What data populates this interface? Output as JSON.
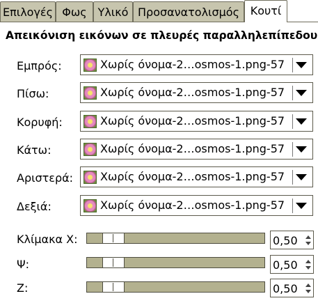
{
  "tabs": [
    {
      "label": "Επιλογές"
    },
    {
      "label": "Φως"
    },
    {
      "label": "Υλικό"
    },
    {
      "label": "Προσανατολισμός"
    },
    {
      "label": "Κουτί"
    }
  ],
  "active_tab": "Κουτί",
  "section_title": "Απεικόνιση εικόνων σε πλευρές παραλληλεπίπεδου",
  "faces": [
    {
      "label": "Εμπρός:",
      "value": "Χωρίς όνομα-2…osmos-1.png-57"
    },
    {
      "label": "Πίσω:",
      "value": "Χωρίς όνομα-2…osmos-1.png-57"
    },
    {
      "label": "Κορυφή:",
      "value": "Χωρίς όνομα-2…osmos-1.png-57"
    },
    {
      "label": "Κάτω:",
      "value": "Χωρίς όνομα-2…osmos-1.png-57"
    },
    {
      "label": "Αριστερά:",
      "value": "Χωρίς όνομα-2…osmos-1.png-57"
    },
    {
      "label": "Δεξιά:",
      "value": "Χωρίς όνομα-2…osmos-1.png-57"
    }
  ],
  "scales": [
    {
      "label": "Κλίμακα X:",
      "value": "0,50"
    },
    {
      "label": "Ψ:",
      "value": "0,50"
    },
    {
      "label": "Z:",
      "value": "0,50"
    }
  ],
  "icons": {
    "image_thumbnail": "flower-thumbnail-icon",
    "combo_arrow": "triangle-down-icon",
    "spin_up": "spin-up-icon",
    "spin_down": "spin-down-icon"
  },
  "colors": {
    "tab_inactive": "#c7c5ae",
    "slider_trough": "#b3b18f",
    "border": "#5c5a4c"
  }
}
